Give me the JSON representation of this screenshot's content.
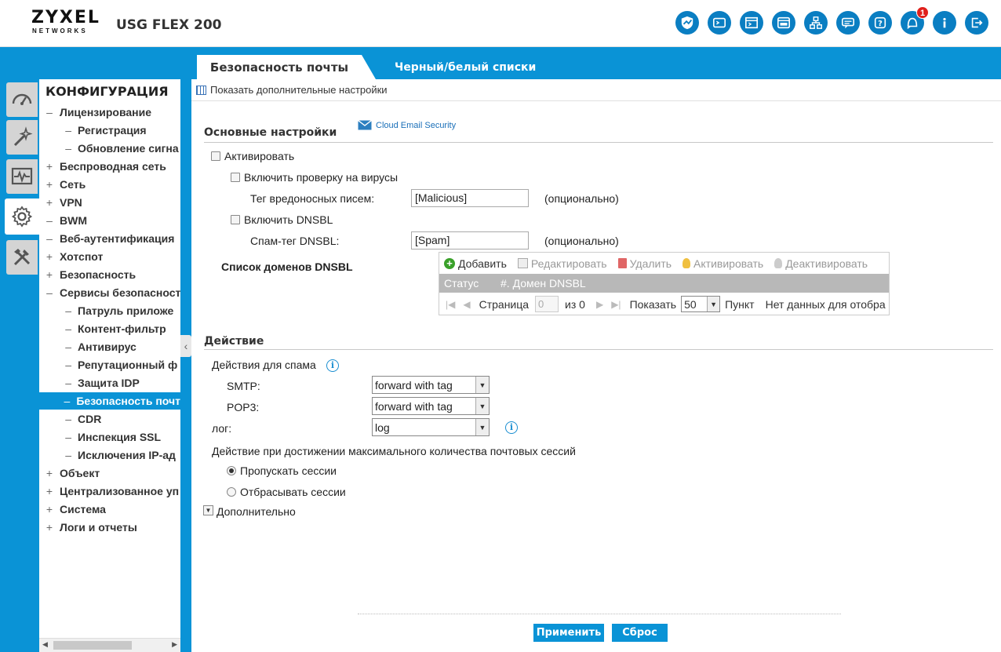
{
  "header": {
    "logo_main": "ZYXEL",
    "logo_sub": "NETWORKS",
    "model": "USG FLEX 200",
    "notification_count": "1",
    "icons": [
      "shield-icon",
      "console-icon",
      "cli-icon",
      "browser-icon",
      "network-icon",
      "chat-icon",
      "help-icon",
      "notification-icon",
      "info-icon",
      "logout-icon"
    ]
  },
  "tabs": {
    "active": "Безопасность почты",
    "inactive": "Черный/белый списки"
  },
  "sidebar": {
    "title": "КОНФИГУРАЦИЯ",
    "items": [
      {
        "sym": "–",
        "label": "Лицензирование",
        "sub": false
      },
      {
        "sym": "–",
        "label": "Регистрация",
        "sub": true
      },
      {
        "sym": "–",
        "label": "Обновление сигна",
        "sub": true
      },
      {
        "sym": "+",
        "label": "Беспроводная сеть",
        "sub": false
      },
      {
        "sym": "+",
        "label": "Сеть",
        "sub": false
      },
      {
        "sym": "+",
        "label": "VPN",
        "sub": false
      },
      {
        "sym": "–",
        "label": "BWM",
        "sub": false
      },
      {
        "sym": "–",
        "label": "Веб-аутентификация",
        "sub": false
      },
      {
        "sym": "+",
        "label": "Хотспот",
        "sub": false
      },
      {
        "sym": "+",
        "label": "Безопасность",
        "sub": false
      },
      {
        "sym": "–",
        "label": "Сервисы безопасност",
        "sub": false
      },
      {
        "sym": "–",
        "label": "Патруль приложе",
        "sub": true
      },
      {
        "sym": "–",
        "label": "Контент-фильтр",
        "sub": true
      },
      {
        "sym": "–",
        "label": "Антивирус",
        "sub": true
      },
      {
        "sym": "–",
        "label": "Репутационный ф",
        "sub": true
      },
      {
        "sym": "–",
        "label": "Защита IDP",
        "sub": true
      },
      {
        "sym": "–",
        "label": "Безопасность почт",
        "sub": true,
        "selected": true
      },
      {
        "sym": "–",
        "label": "CDR",
        "sub": true
      },
      {
        "sym": "–",
        "label": "Инспекция SSL",
        "sub": true
      },
      {
        "sym": "–",
        "label": "Исключения IP-ад",
        "sub": true
      },
      {
        "sym": "+",
        "label": "Объект",
        "sub": false
      },
      {
        "sym": "+",
        "label": "Централизованное уп",
        "sub": false
      },
      {
        "sym": "+",
        "label": "Система",
        "sub": false
      },
      {
        "sym": "+",
        "label": "Логи и отчеты",
        "sub": false
      }
    ]
  },
  "main": {
    "show_advanced": "Показать дополнительные настройки",
    "basic_section": "Основные настройки",
    "cloud_email": "Cloud Email Security",
    "activate": "Активировать",
    "enable_virus_check": "Включить проверку на вирусы",
    "malicious_tag_label": "Тег вредоносных писем:",
    "malicious_tag_value": "[Malicious]",
    "optional1": "(опционально)",
    "enable_dnsbl": "Включить DNSBL",
    "dnsbl_tag_label": "Спам-тег DNSBL:",
    "dnsbl_tag_value": "[Spam]",
    "optional2": "(опционально)",
    "dnsbl_list_label": "Список доменов DNSBL",
    "grid": {
      "add": "Добавить",
      "edit": "Редактировать",
      "delete": "Удалить",
      "activate": "Активировать",
      "deactivate": "Деактивировать",
      "col_status": "Статус",
      "col_domain": "#. Домен DNSBL",
      "page_label": "Страница",
      "page_value": "0",
      "of_pages": "из 0",
      "show_label": "Показать",
      "per_page": "50",
      "item_label": "Пункт",
      "no_data": "Нет данных для отобра"
    },
    "action_section": "Действие",
    "spam_actions": "Действия для спама",
    "smtp_label": "SMTP:",
    "smtp_value": "forward with tag",
    "pop3_label": "POP3:",
    "pop3_value": "forward with tag",
    "log_label": "лог:",
    "log_value": "log",
    "max_sessions_label": "Действие при достижении максимального количества почтовых сессий",
    "radio_pass": "Пропускать сессии",
    "radio_drop": "Отбрасывать сессии",
    "advanced": "Дополнительно",
    "apply": "Применить",
    "reset": "Сброс"
  }
}
